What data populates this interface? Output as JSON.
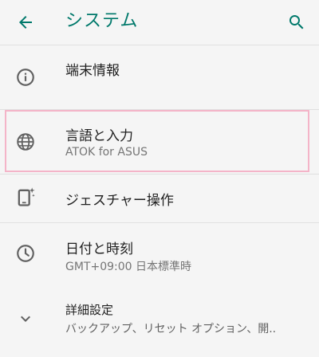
{
  "appbar": {
    "title": "システム",
    "accent_color": "#00796b",
    "back_icon": "arrow-left-icon",
    "search_icon": "search-icon"
  },
  "items": [
    {
      "icon": "info-icon",
      "label": "端末情報"
    },
    {
      "icon": "globe-icon",
      "label": "言語と入力",
      "sub": "ATOK for ASUS",
      "highlight_color": "#f4b4c8"
    },
    {
      "icon": "phone-gesture-icon",
      "label": "ジェスチャー操作"
    },
    {
      "icon": "clock-icon",
      "label": "日付と時刻",
      "sub": "GMT+09:00 日本標準時"
    },
    {
      "icon": "chevron-down-icon",
      "label": "詳細設定",
      "sub": "バックアップ、リセット オプション、開.."
    }
  ]
}
